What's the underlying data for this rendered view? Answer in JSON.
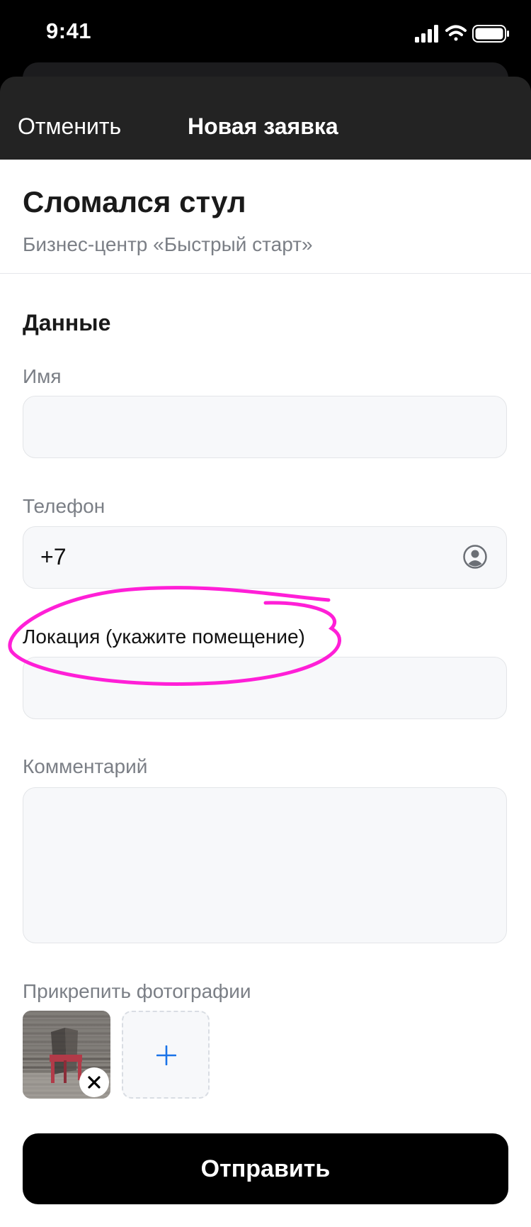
{
  "status_bar": {
    "time": "9:41",
    "icons": [
      "cellular-signal-icon",
      "wifi-icon",
      "battery-icon"
    ]
  },
  "nav": {
    "cancel_label": "Отменить",
    "title": "Новая заявка"
  },
  "request": {
    "title": "Сломался стул",
    "subtitle": "Бизнес-центр «Быстрый старт»"
  },
  "form": {
    "section_title": "Данные",
    "name_label": "Имя",
    "name_value": "",
    "phone_label": "Телефон",
    "phone_value": "+7",
    "location_label": "Локация (укажите помещение)",
    "location_value": "",
    "comment_label": "Комментарий",
    "comment_value": "",
    "photos_label": "Прикрепить фотографии",
    "photos": [
      {
        "name": "chair-photo-thumbnail"
      }
    ]
  },
  "actions": {
    "submit_label": "Отправить"
  },
  "colors": {
    "accent": "#1a73e8",
    "annotation": "#ff1fd7",
    "nav_background": "#232323",
    "field_background": "#f7f8fa"
  }
}
